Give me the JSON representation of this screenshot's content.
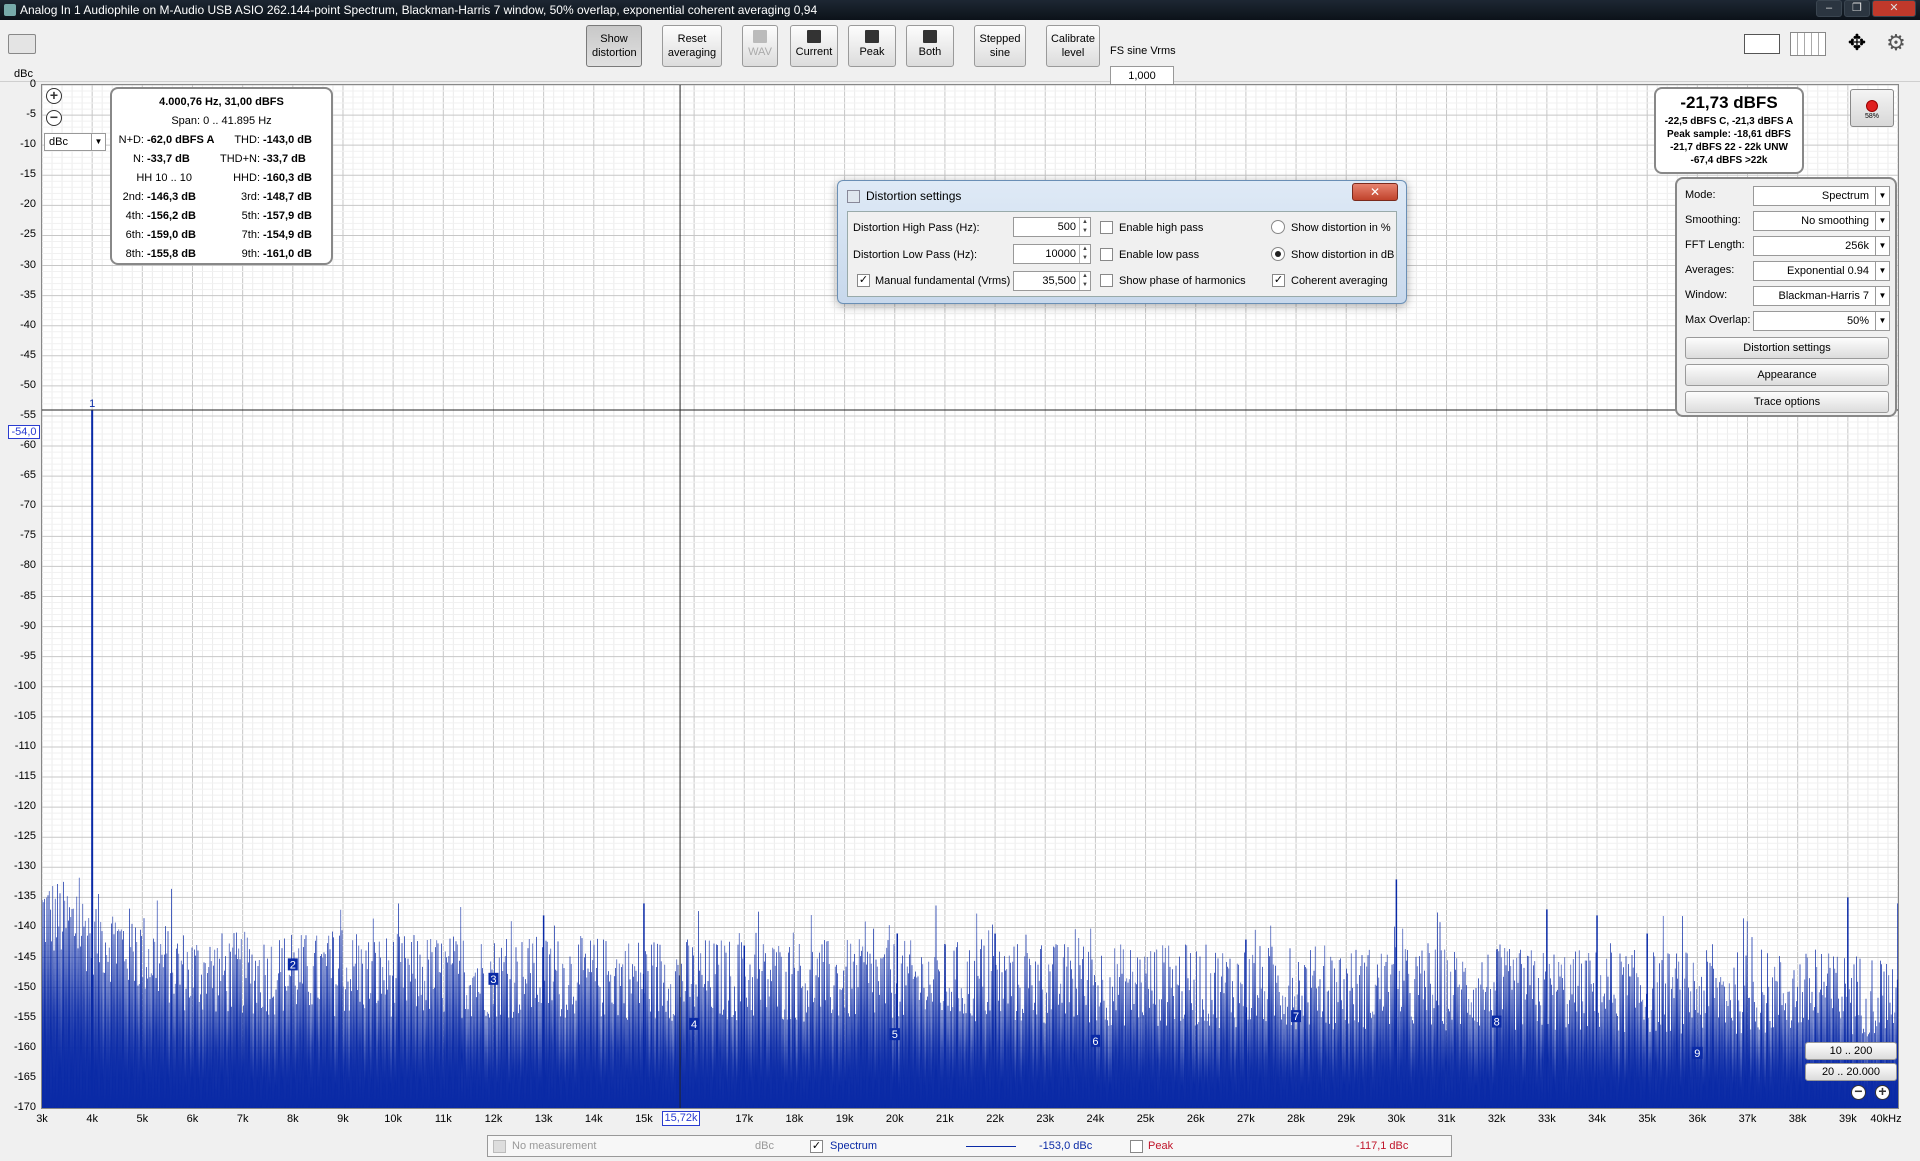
{
  "window": {
    "title": "Analog In 1 Audiophile on M-Audio USB ASIO 262.144-point Spectrum, Blackman-Harris 7 window, 50% overlap, exponential coherent averaging 0,94"
  },
  "toolbar": {
    "show_distortion": "Show distortion",
    "reset_averaging": "Reset averaging",
    "wav": "WAV",
    "current": "Current",
    "peak": "Peak",
    "both": "Both",
    "stepped_sine": "Stepped sine",
    "calibrate_level": "Calibrate level",
    "fs_label": "FS sine Vrms",
    "fs_value": "1,000"
  },
  "axis": {
    "y_unit": "dBc",
    "y_select": "dBc",
    "y_cursor": "-54,0",
    "x_cursor": "15,72k",
    "y_ticks": [
      "0",
      "-5",
      "-10",
      "-15",
      "-20",
      "-25",
      "-30",
      "-35",
      "-40",
      "-45",
      "-50",
      "-55",
      "-60",
      "-65",
      "-70",
      "-75",
      "-80",
      "-85",
      "-90",
      "-95",
      "-100",
      "-105",
      "-110",
      "-115",
      "-120",
      "-125",
      "-130",
      "-135",
      "-140",
      "-145",
      "-150",
      "-155",
      "-160",
      "-165",
      "-170"
    ],
    "x_ticks": [
      "3k",
      "4k",
      "5k",
      "6k",
      "7k",
      "8k",
      "9k",
      "10k",
      "11k",
      "12k",
      "13k",
      "14k",
      "15k",
      "",
      "17k",
      "18k",
      "19k",
      "20k",
      "21k",
      "22k",
      "23k",
      "24k",
      "25k",
      "26k",
      "27k",
      "28k",
      "29k",
      "30k",
      "31k",
      "32k",
      "33k",
      "34k",
      "35k",
      "36k",
      "37k",
      "38k",
      "39k",
      "40kHz"
    ]
  },
  "stats": {
    "header": "4.000,76 Hz, 31,00 dBFS",
    "span": "Span: 0 .. 41.895 Hz",
    "rows": [
      {
        "l1": "N+D:",
        "v1": "-62,0 dBFS A",
        "l2": "THD:",
        "v2": "-143,0 dB"
      },
      {
        "l1": "N:",
        "v1": "-33,7 dB",
        "l2": "THD+N:",
        "v2": "-33,7 dB"
      },
      {
        "l1": "HH 10 .. 10",
        "v1": "",
        "l2": "HHD:",
        "v2": "-160,3 dB"
      },
      {
        "l1": "2nd:",
        "v1": "-146,3 dB",
        "l2": "3rd:",
        "v2": "-148,7 dB"
      },
      {
        "l1": "4th:",
        "v1": "-156,2 dB",
        "l2": "5th:",
        "v2": "-157,9 dB"
      },
      {
        "l1": "6th:",
        "v1": "-159,0 dB",
        "l2": "7th:",
        "v2": "-154,9 dB"
      },
      {
        "l1": "8th:",
        "v1": "-155,8 dB",
        "l2": "9th:",
        "v2": "-161,0 dB"
      }
    ]
  },
  "level": {
    "main": "-21,73 dBFS",
    "line1": "-22,5 dBFS C, -21,3 dBFS A",
    "line2": "Peak sample: -18,61 dBFS",
    "line3": "-21,7 dBFS 22 - 22k UNW",
    "line4": "-67,4 dBFS >22k",
    "rec_pct": "58%"
  },
  "settings": {
    "mode_label": "Mode:",
    "mode": "Spectrum",
    "smoothing_label": "Smoothing:",
    "smoothing": "No  smoothing",
    "fft_label": "FFT Length:",
    "fft": "256k",
    "averages_label": "Averages:",
    "averages": "Exponential 0.94",
    "window_label": "Window:",
    "window": "Blackman-Harris 7",
    "overlap_label": "Max Overlap:",
    "overlap": "50%",
    "distortion_btn": "Distortion settings",
    "appearance_btn": "Appearance",
    "trace_btn": "Trace options"
  },
  "dialog": {
    "title": "Distortion settings",
    "hp_label": "Distortion High Pass (Hz):",
    "hp_value": "500",
    "lp_label": "Distortion Low Pass (Hz):",
    "lp_value": "10000",
    "mf_label": "Manual fundamental (Vrms)",
    "mf_value": "35,500",
    "enable_hp": "Enable high pass",
    "enable_lp": "Enable low pass",
    "show_phase": "Show phase of harmonics",
    "show_pct": "Show distortion in %",
    "show_db": "Show distortion in dB",
    "coherent": "Coherent averaging"
  },
  "range_buttons": {
    "r1": "10 .. 200",
    "r2": "20 .. 20.000"
  },
  "legend": {
    "no_meas": "No measurement",
    "no_meas_unit": "dBc",
    "spectrum": "Spectrum",
    "spectrum_val": "-153,0 dBc",
    "peak": "Peak",
    "peak_val": "-117,1 dBc"
  },
  "colors": {
    "trace": "#0a2aa6",
    "peak": "#c0152a",
    "accent": "#2a3cd0"
  },
  "chart_data": {
    "type": "line",
    "xlabel": "",
    "ylabel": "dBc",
    "xlim": [
      3000,
      40000
    ],
    "ylim": [
      -170,
      0
    ],
    "grid": true,
    "series": [
      {
        "name": "Spectrum",
        "x": [
          3000,
          4000,
          8000,
          12000,
          16000,
          20000,
          24000,
          32000,
          36000,
          40000
        ],
        "values": [
          -130,
          -54,
          -146,
          -152,
          -152,
          -148,
          -154,
          -158,
          -166,
          -140
        ]
      }
    ],
    "harmonic_markers": [
      {
        "label": "1",
        "x": 4000,
        "y": -54
      },
      {
        "label": "2",
        "x": 8000,
        "y": -146.3
      },
      {
        "label": "3",
        "x": 12000,
        "y": -148.7
      },
      {
        "label": "4",
        "x": 16000,
        "y": -156.2
      },
      {
        "label": "5",
        "x": 20000,
        "y": -157.9
      },
      {
        "label": "6",
        "x": 24000,
        "y": -159.0
      },
      {
        "label": "7",
        "x": 28000,
        "y": -154.9
      },
      {
        "label": "8",
        "x": 32000,
        "y": -155.8
      },
      {
        "label": "9",
        "x": 36000,
        "y": -161.0
      }
    ],
    "spikes": [
      {
        "x": 13000,
        "y": -138
      },
      {
        "x": 15000,
        "y": -136
      },
      {
        "x": 17000,
        "y": -143
      },
      {
        "x": 20050,
        "y": -141
      },
      {
        "x": 22000,
        "y": -141
      },
      {
        "x": 27000,
        "y": -142
      },
      {
        "x": 30000,
        "y": -132
      },
      {
        "x": 33000,
        "y": -137
      },
      {
        "x": 34000,
        "y": -138
      },
      {
        "x": 35000,
        "y": -141
      },
      {
        "x": 39000,
        "y": -135
      },
      {
        "x": 40000,
        "y": -136
      }
    ]
  }
}
